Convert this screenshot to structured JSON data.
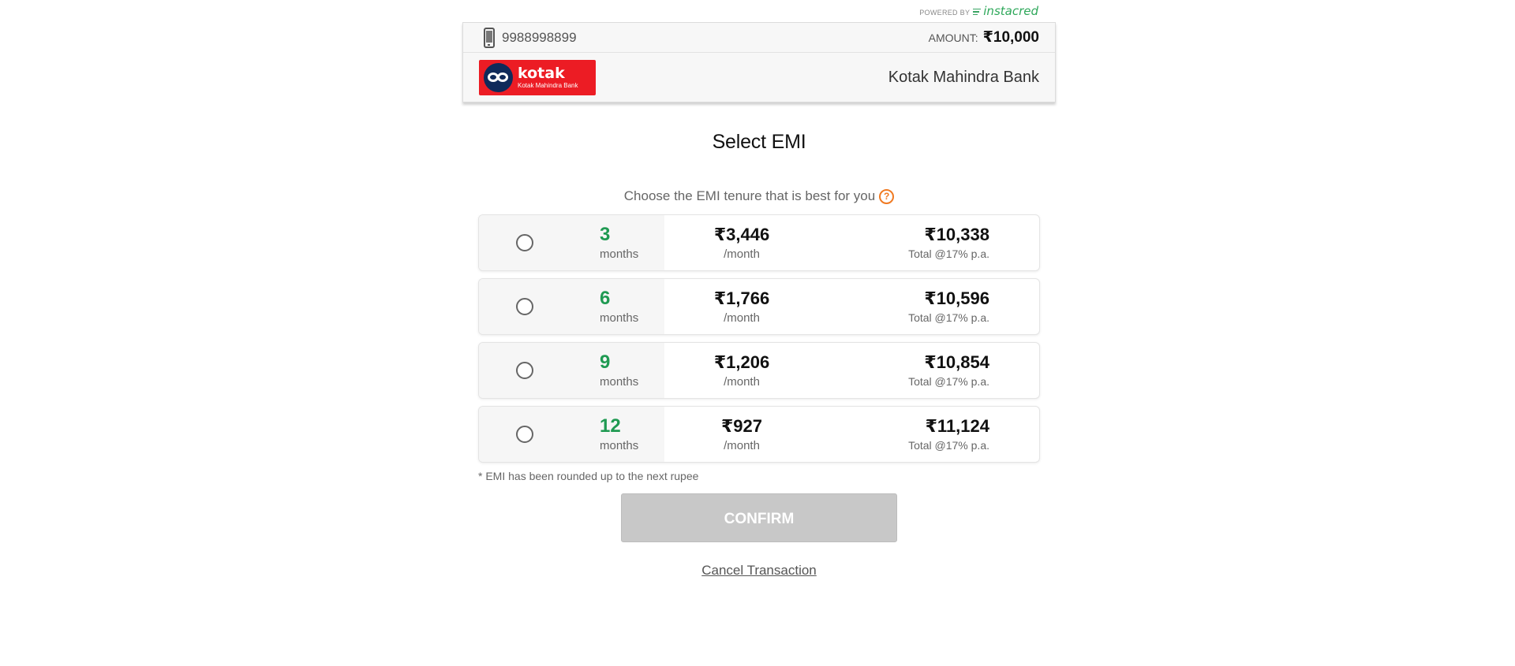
{
  "powered": {
    "prefix": "POWERED BY",
    "brand": "instacred"
  },
  "header": {
    "phone": "9988998899",
    "amount_label": "AMOUNT:",
    "amount_value": "₹10,000",
    "bank_logo": {
      "main": "kotak",
      "sub": "Kotak Mahindra Bank"
    },
    "bank_name": "Kotak Mahindra Bank"
  },
  "page": {
    "title": "Select EMI",
    "subtitle": "Choose the EMI tenure that is best for you",
    "note": "* EMI has been rounded up to the next rupee",
    "confirm_label": "CONFIRM",
    "cancel_label": "Cancel Transaction"
  },
  "options": [
    {
      "months": "3",
      "unit": "months",
      "emi": "₹3,446",
      "per": "/month",
      "total": "₹10,338",
      "total_note": "Total @17% p.a."
    },
    {
      "months": "6",
      "unit": "months",
      "emi": "₹1,766",
      "per": "/month",
      "total": "₹10,596",
      "total_note": "Total @17% p.a."
    },
    {
      "months": "9",
      "unit": "months",
      "emi": "₹1,206",
      "per": "/month",
      "total": "₹10,854",
      "total_note": "Total @17% p.a."
    },
    {
      "months": "12",
      "unit": "months",
      "emi": "₹927",
      "per": "/month",
      "total": "₹11,124",
      "total_note": "Total @17% p.a."
    }
  ],
  "colors": {
    "accent_green": "#1f9a52",
    "brand_red": "#ec1c24",
    "help_orange": "#f07a22",
    "confirm_disabled": "#c8c8c8"
  }
}
